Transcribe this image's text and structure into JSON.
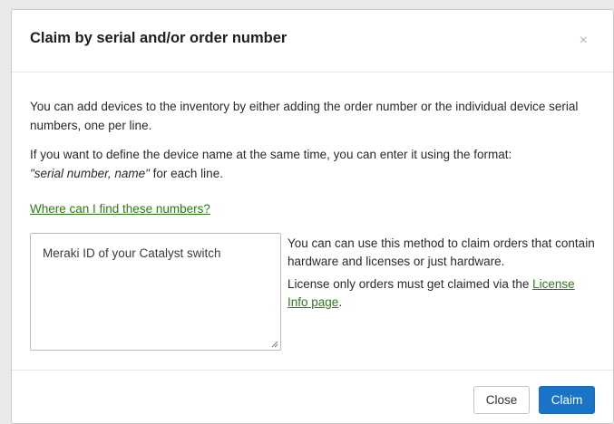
{
  "dialog": {
    "title": "Claim by serial and/or order number",
    "close_icon": "×"
  },
  "intro": {
    "paragraph1": "You can add devices to the inventory by either adding the order number or the individual device serial numbers, one per line.",
    "paragraph2_prefix": "If you want to define the device name at the same time, you can enter it using the format:",
    "paragraph2_format": "\"serial number, name\"",
    "paragraph2_suffix": " for each line.",
    "help_link": "Where can I find these numbers?"
  },
  "claim_input": {
    "placeholder": "Meraki ID of your Catalyst switch",
    "value": ""
  },
  "side_info": {
    "line1": "You can can use this method to claim orders that contain hardware and licenses or just hardware.",
    "line2_prefix": "License only orders must get claimed via the ",
    "line2_link": "License Info page",
    "line2_suffix": "."
  },
  "footer": {
    "close_label": "Close",
    "claim_label": "Claim"
  },
  "colors": {
    "link": "#2c7a16",
    "primary_button": "#1a73c6"
  }
}
